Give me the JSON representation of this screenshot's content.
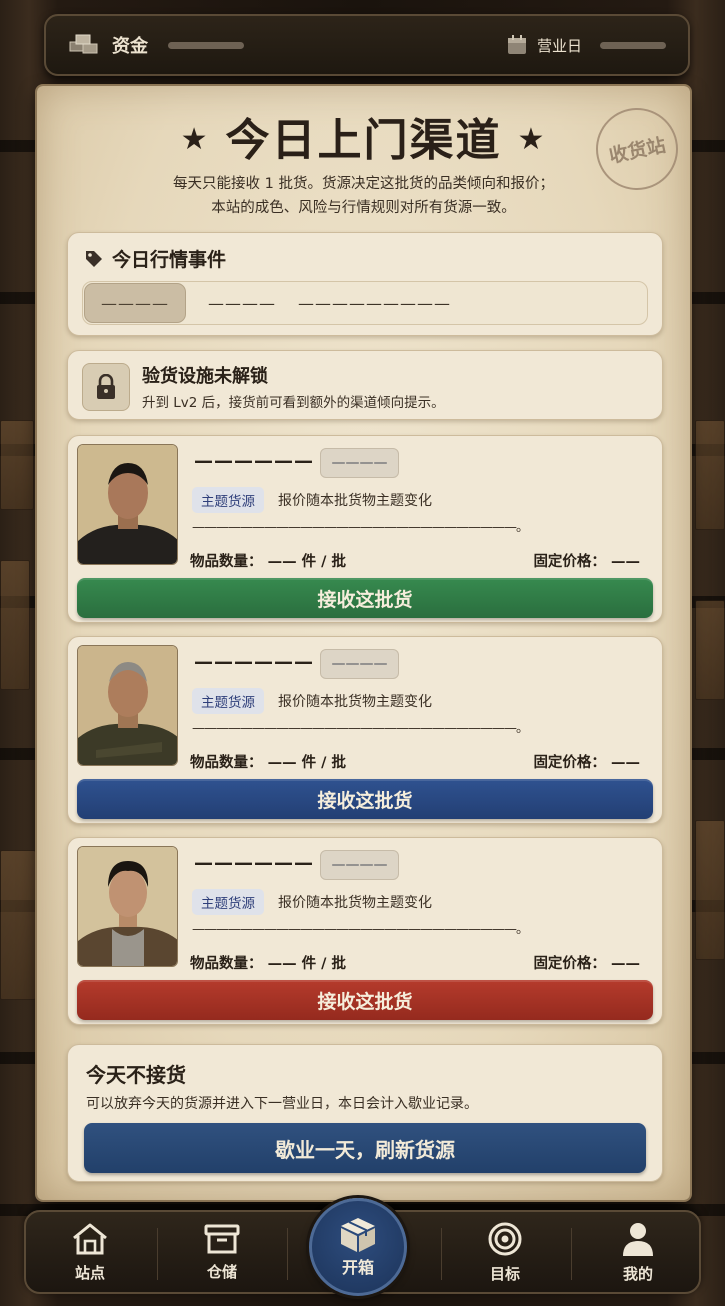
{
  "topbar": {
    "funds_label": "资金",
    "day_label": "营业日"
  },
  "header": {
    "title": "今日上门渠道",
    "star_left": "★",
    "star_right": "★",
    "stamp": "收货站",
    "subtitle_line1": "每天只能接收 1 批货。货源决定这批货的品类倾向和报价；",
    "subtitle_line2": "本站的成色、风险与行情规则对所有货源一致。"
  },
  "events": {
    "title": "今日行情事件",
    "tabs": [
      "————",
      "————",
      "—————————"
    ]
  },
  "inspection": {
    "title": "验货设施未解锁",
    "desc": "升到 Lv2 后，接货前可看到额外的渠道倾向提示。"
  },
  "suppliers": [
    {
      "name": "——————",
      "badge": "————",
      "theme_tag": "主题货源",
      "theme_desc": "报价随本批货物主题变化",
      "line": "———————————————————————————。",
      "qty_label": "物品数量：",
      "qty_value": "—— 件 / 批",
      "price_label": "固定价格：",
      "price_value": "——",
      "button": "接收这批货",
      "color": "#2f7a45"
    },
    {
      "name": "——————",
      "badge": "————",
      "theme_tag": "主题货源",
      "theme_desc": "报价随本批货物主题变化",
      "line": "———————————————————————————。",
      "qty_label": "物品数量：",
      "qty_value": "—— 件 / 批",
      "price_label": "固定价格：",
      "price_value": "——",
      "button": "接收这批货",
      "color": "#26467f"
    },
    {
      "name": "——————",
      "badge": "————",
      "theme_tag": "主题货源",
      "theme_desc": "报价随本批货物主题变化",
      "line": "———————————————————————————。",
      "qty_label": "物品数量：",
      "qty_value": "—— 件 / 批",
      "price_label": "固定价格：",
      "price_value": "——",
      "button": "接收这批货",
      "color": "#a83325"
    }
  ],
  "skip": {
    "title": "今天不接货",
    "desc": "可以放弃今天的货源并进入下一营业日，本日会计入歇业记录。",
    "button": "歇业一天，刷新货源"
  },
  "nav": {
    "station": "站点",
    "storage": "仓储",
    "unbox": "开箱",
    "goals": "目标",
    "mine": "我的"
  },
  "icons": {
    "funds": "coins-stack-icon",
    "calendar": "calendar-icon",
    "tag": "tag-icon",
    "lock": "lock-icon",
    "station": "home-icon",
    "storage": "archive-box-icon",
    "unbox": "package-icon",
    "goals": "target-icon",
    "mine": "user-icon"
  }
}
